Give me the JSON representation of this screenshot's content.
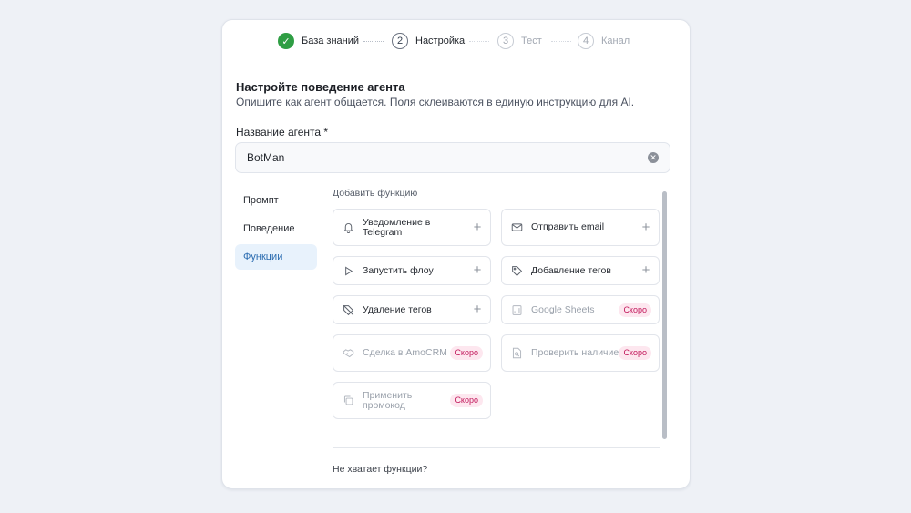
{
  "stepper": {
    "steps": [
      {
        "number": "✓",
        "label": "База знаний",
        "state": "done"
      },
      {
        "number": "2",
        "label": "Настройка",
        "state": "active"
      },
      {
        "number": "3",
        "label": "Тест",
        "state": "pending"
      },
      {
        "number": "4",
        "label": "Канал",
        "state": "pending"
      }
    ]
  },
  "header": {
    "title": "Настройте поведение агента",
    "subtitle": "Опишите как агент общается. Поля склеиваются в единую инструкцию для AI."
  },
  "agent_name": {
    "label": "Название агента *",
    "value": "BotMan",
    "clear_icon": "clear-icon"
  },
  "tabs": [
    {
      "label": "Промпт",
      "active": false
    },
    {
      "label": "Поведение",
      "active": false
    },
    {
      "label": "Функции",
      "active": true
    }
  ],
  "functions": {
    "section_label": "Добавить функцию",
    "items": [
      {
        "label": "Уведомление в Telegram",
        "icon": "bell-icon",
        "action": "+",
        "soon": false
      },
      {
        "label": "Отправить email",
        "icon": "mail-icon",
        "action": "+",
        "soon": false
      },
      {
        "label": "Запустить флоу",
        "icon": "play-icon",
        "action": "+",
        "soon": false
      },
      {
        "label": "Добавление тегов",
        "icon": "tag-icon",
        "action": "+",
        "soon": false
      },
      {
        "label": "Удаление тегов",
        "icon": "tag-off-icon",
        "action": "+",
        "soon": false
      },
      {
        "label": "Google Sheets",
        "icon": "sheet-icon",
        "badge": "Скоро",
        "soon": true
      },
      {
        "label": "Сделка в AmoCRM",
        "icon": "handshake-icon",
        "badge": "Скоро",
        "soon": true
      },
      {
        "label": "Проверить наличие",
        "icon": "doc-search-icon",
        "badge": "Скоро",
        "soon": true
      },
      {
        "label": "Применить промокод",
        "icon": "copy-icon",
        "badge": "Скоро",
        "soon": true
      }
    ],
    "missing_link": "Не хватает функции?"
  },
  "colors": {
    "background": "#eef1f6",
    "done": "#2f9e44",
    "active_tab_bg": "#e8f2fc",
    "active_tab_text": "#2b6cb0",
    "badge_text": "#c2185b",
    "badge_bg": "#fde7ef"
  }
}
